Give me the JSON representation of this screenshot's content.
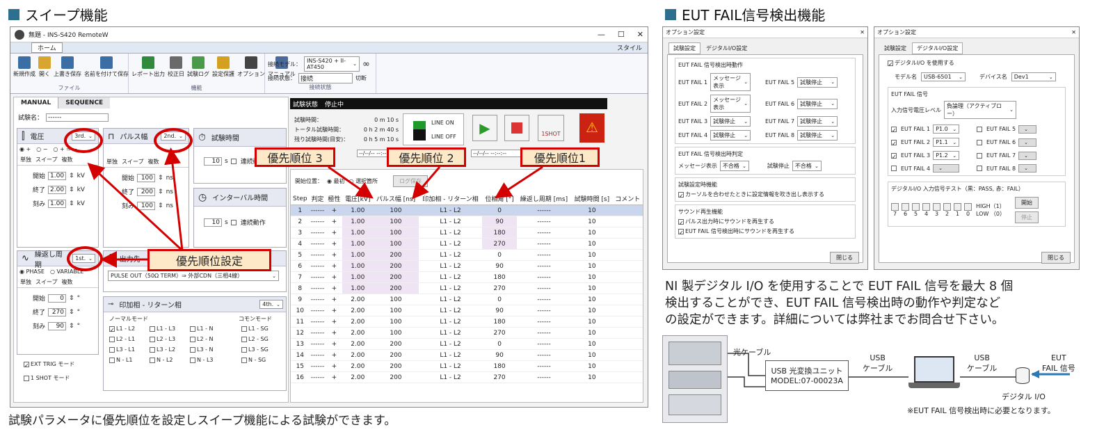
{
  "left_heading": "スイープ機能",
  "right_heading": "EUT FAIL信号検出機能",
  "left_caption": "試験パラメータに優先順位を設定しスイープ機能による試験ができます。",
  "right_desc": [
    "NI 製デジタル I/O を使用することで EUT FAIL 信号を最大 8 個",
    "検出することができ、EUT FAIL 信号検出時の動作や判定など",
    "の設定ができます。詳細については弊社までお問合せ下さい。"
  ],
  "app": {
    "title": "無題 - INS-S420 RemoteW",
    "ribbon_tab": "ホーム",
    "style_label": "スタイル",
    "groups": [
      {
        "label": "ファイル",
        "buttons": [
          "新規作成",
          "開く",
          "上書き保存",
          "名前を付けて保存"
        ]
      },
      {
        "label": "機能",
        "buttons": [
          "レポート出力",
          "校正日",
          "試験ログ",
          "設定保護",
          "オプション",
          "マニュアル"
        ]
      }
    ],
    "conn": {
      "label": "接続状態",
      "model_label": "接続モデル：",
      "model_value": "INS-S420 + II-AT450",
      "status_label": "接続状態：",
      "status_value": "接続",
      "disconnect": "切断"
    }
  },
  "mode_tabs": [
    "MANUAL",
    "SEQUENCE"
  ],
  "test_name_label": "試験名：",
  "test_name_value": "------",
  "voltage": {
    "title": "電圧",
    "priority": "3rd.",
    "pol": [
      "+",
      "−",
      "+ ⇒ −"
    ],
    "tabs": [
      "単独",
      "スイープ",
      "複数"
    ],
    "rows": [
      {
        "label": "開始",
        "value": "1.00",
        "unit": "kV"
      },
      {
        "label": "終了",
        "value": "2.00",
        "unit": "kV"
      },
      {
        "label": "刻み",
        "value": "1.00",
        "unit": "kV"
      }
    ]
  },
  "pulse": {
    "title": "パルス幅",
    "priority": "2nd.",
    "tabs": [
      "単独",
      "スイープ",
      "複数"
    ],
    "rows": [
      {
        "label": "開始",
        "value": "100",
        "unit": "ns"
      },
      {
        "label": "終了",
        "value": "200",
        "unit": "ns"
      },
      {
        "label": "刻み",
        "value": "100",
        "unit": "ns"
      }
    ]
  },
  "test_time": {
    "title": "試験時間",
    "value": "10",
    "unit": "s",
    "cont": "連続動作"
  },
  "interval": {
    "title": "インターバル時間",
    "value": "10",
    "unit": "s",
    "cont": "連続動作"
  },
  "repeat": {
    "title": "繰返し周期",
    "priority": "1st.",
    "modes": [
      "PHASE",
      "VARIABLE"
    ],
    "tabs": [
      "単独",
      "スイープ",
      "複数"
    ],
    "rows": [
      {
        "label": "開始",
        "value": "0",
        "unit": "°"
      },
      {
        "label": "終了",
        "value": "270",
        "unit": "°"
      },
      {
        "label": "刻み",
        "value": "90",
        "unit": "°"
      }
    ]
  },
  "output": {
    "title": "出力先",
    "value": "PULSE OUT（50Ω TERM）⇒ 外部CDN（三相4線）"
  },
  "phase": {
    "title": "印加相 - リターン相",
    "priority": "4th.",
    "normal_label": "ノーマルモード",
    "common_label": "コモンモード",
    "normal": [
      "L1 - L2",
      "L1 - L3",
      "L1 - N",
      "L2 - L1",
      "L2 - L3",
      "L2 - N",
      "L3 - L1",
      "L3 - L2",
      "L3 - N",
      "N - L1",
      "N - L2",
      "N - L3"
    ],
    "common": [
      "L1 - SG",
      "L2 - SG",
      "L3 - SG",
      "N - SG"
    ]
  },
  "ext_trig": "EXT TRIG モード",
  "one_shot": "1 SHOT モード",
  "status": {
    "label": "試験状態",
    "value": "停止中",
    "lines": [
      {
        "label": "試験時間：",
        "value": "0 m  10 s"
      },
      {
        "label": "トータル試験時間：",
        "value": "0 h  2 m  40 s"
      },
      {
        "label": "残り試験時間(目安)：",
        "value": "0 h  5 m  10 s"
      }
    ],
    "line_on": "LINE ON",
    "line_off": "LINE OFF",
    "oneshot": "1SHOT",
    "date_a": "--/--/-- --:--",
    "date_b": "--/--/-- --:--:--"
  },
  "seq": {
    "start_label": "開始位置：",
    "start_opts": [
      "最初",
      "選択箇所"
    ],
    "log_save": "ログ保存",
    "headers": [
      "Step",
      "判定",
      "極性",
      "電圧[kV]",
      "パルス幅 [ns]",
      "印加相 - リターン相",
      "位相角 [°]",
      "繰返し周期 [ms]",
      "試験時間 [s]",
      "コメント"
    ],
    "rows": [
      [
        "1",
        "------",
        "+",
        "1.00",
        "100",
        "L1 - L2",
        "0",
        "------",
        "10"
      ],
      [
        "2",
        "------",
        "+",
        "1.00",
        "100",
        "L1 - L2",
        "90",
        "------",
        "10"
      ],
      [
        "3",
        "------",
        "+",
        "1.00",
        "100",
        "L1 - L2",
        "180",
        "------",
        "10"
      ],
      [
        "4",
        "------",
        "+",
        "1.00",
        "100",
        "L1 - L2",
        "270",
        "------",
        "10"
      ],
      [
        "5",
        "------",
        "+",
        "1.00",
        "200",
        "L1 - L2",
        "0",
        "------",
        "10"
      ],
      [
        "6",
        "------",
        "+",
        "1.00",
        "200",
        "L1 - L2",
        "90",
        "------",
        "10"
      ],
      [
        "7",
        "------",
        "+",
        "1.00",
        "200",
        "L1 - L2",
        "180",
        "------",
        "10"
      ],
      [
        "8",
        "------",
        "+",
        "1.00",
        "200",
        "L1 - L2",
        "270",
        "------",
        "10"
      ],
      [
        "9",
        "------",
        "+",
        "2.00",
        "100",
        "L1 - L2",
        "0",
        "------",
        "10"
      ],
      [
        "10",
        "------",
        "+",
        "2.00",
        "100",
        "L1 - L2",
        "90",
        "------",
        "10"
      ],
      [
        "11",
        "------",
        "+",
        "2.00",
        "100",
        "L1 - L2",
        "180",
        "------",
        "10"
      ],
      [
        "12",
        "------",
        "+",
        "2.00",
        "100",
        "L1 - L2",
        "270",
        "------",
        "10"
      ],
      [
        "13",
        "------",
        "+",
        "2.00",
        "200",
        "L1 - L2",
        "0",
        "------",
        "10"
      ],
      [
        "14",
        "------",
        "+",
        "2.00",
        "200",
        "L1 - L2",
        "90",
        "------",
        "10"
      ],
      [
        "15",
        "------",
        "+",
        "2.00",
        "200",
        "L1 - L2",
        "180",
        "------",
        "10"
      ],
      [
        "16",
        "------",
        "+",
        "2.00",
        "200",
        "L1 - L2",
        "270",
        "------",
        "10"
      ]
    ]
  },
  "callouts": {
    "p3": "優先順位 3",
    "p2": "優先順位 2",
    "p1": "優先順位1",
    "set": "優先順位設定"
  },
  "dlg1": {
    "title": "オプション設定",
    "tabs": [
      "試験設定",
      "デジタルI/O設定"
    ],
    "g1": "EUT FAIL 信号検出時動作",
    "fails": [
      {
        "l": "EUT FAIL 1",
        "v": "メッセージ表示"
      },
      {
        "l": "EUT FAIL 2",
        "v": "メッセージ表示"
      },
      {
        "l": "EUT FAIL 3",
        "v": "試験停止"
      },
      {
        "l": "EUT FAIL 4",
        "v": "試験停止"
      },
      {
        "l": "EUT FAIL 5",
        "v": "試験停止"
      },
      {
        "l": "EUT FAIL 6",
        "v": "試験停止"
      },
      {
        "l": "EUT FAIL 7",
        "v": "試験停止"
      },
      {
        "l": "EUT FAIL 8",
        "v": "試験停止"
      }
    ],
    "g2": "EUT FAIL 信号検出時判定",
    "msg_label": "メッセージ表示",
    "msg_val": "不合格",
    "stop_label": "試験停止",
    "stop_val": "不合格",
    "g3": "試験設定時機能",
    "g3c": "カーソルを合わせたときに設定情報を吹き出し表示する",
    "g4": "サウンド再生機能",
    "g4a": "パルス出力時にサウンドを再生する",
    "g4b": "EUT FAIL 信号検出時にサウンドを再生する",
    "close": "閉じる"
  },
  "dlg2": {
    "title": "オプション設定",
    "tabs": [
      "試験設定",
      "デジタルI/O設定"
    ],
    "use": "デジタルI/O を使用する",
    "model_label": "モデル名",
    "model": "USB-6501",
    "dev_label": "デバイス名",
    "dev": "Dev1",
    "sig": "EUT FAIL 信号",
    "level_label": "入力信号電圧レベル",
    "level": "負論理（アクティブロー）",
    "ch": [
      {
        "l": "EUT FAIL 1",
        "v": "P1.0"
      },
      {
        "l": "EUT FAIL 2",
        "v": "P1.1"
      },
      {
        "l": "EUT FAIL 3",
        "v": "P1.2"
      },
      {
        "l": "EUT FAIL 4",
        "v": ""
      }
    ],
    "ch2": [
      "EUT FAIL 5",
      "EUT FAIL 6",
      "EUT FAIL 7",
      "EUT FAIL 8"
    ],
    "test": "デジタルI/O 入力信号テスト（黒：PASS, 赤：FAIL）",
    "bits": [
      "7",
      "6",
      "5",
      "4",
      "3",
      "2",
      "1",
      "0"
    ],
    "high": "HIGH（1）",
    "low": "LOW （0）",
    "start": "開始",
    "stop": "停止",
    "close": "閉じる"
  },
  "diagram": {
    "optical": "光ケーブル",
    "unit_name": "USB 光変換ユニット",
    "unit_model": "MODEL:07-00023A",
    "usb1": "USB\nケーブル",
    "usb2": "USB\nケーブル",
    "eut": "EUT\nFAIL 信号",
    "dio": "デジタル I/O",
    "note": "※EUT FAIL 信号検出時に必要となります。"
  }
}
